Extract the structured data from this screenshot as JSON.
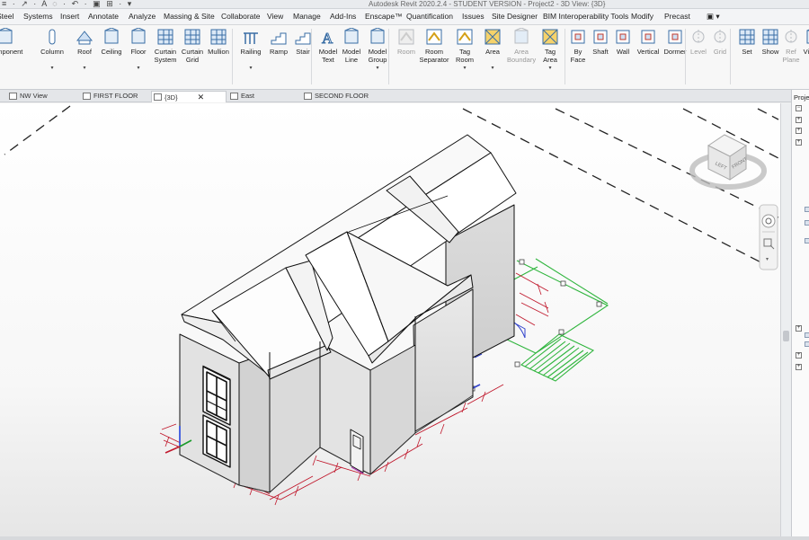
{
  "titlebar": {
    "quick_access": "≡ · ↗ · A  ◌ · ↶ · ▣  ⊞ · ▾",
    "title": "Autodesk Revit 2020.2.4 - STUDENT VERSION - Project2 - 3D View: {3D}"
  },
  "menu": {
    "tabs": [
      "Steel",
      "Systems",
      "Insert",
      "Annotate",
      "Analyze",
      "Massing & Site",
      "Collaborate",
      "View",
      "Manage",
      "Add-Ins",
      "Enscape™",
      "Quantification",
      "Issues",
      "Site Designer",
      "BIM Interoperability Tools",
      "Modify",
      "Precast",
      "▣ ▾"
    ]
  },
  "ribbon": {
    "buttons": [
      {
        "id": "component",
        "label": "Component",
        "icon": "component-icon",
        "disabled": false
      },
      {
        "id": "column",
        "label": "Column",
        "icon": "column-icon",
        "disabled": false,
        "dropdown": true
      },
      {
        "id": "roof",
        "label": "Roof",
        "icon": "roof-icon",
        "disabled": false,
        "dropdown": true
      },
      {
        "id": "ceiling",
        "label": "Ceiling",
        "icon": "ceiling-icon",
        "disabled": false
      },
      {
        "id": "floor",
        "label": "Floor",
        "icon": "floor-icon",
        "disabled": false,
        "dropdown": true
      },
      {
        "id": "curtain-system",
        "label": "Curtain\nSystem",
        "icon": "curtain-system-icon",
        "disabled": false
      },
      {
        "id": "curtain-grid",
        "label": "Curtain\nGrid",
        "icon": "curtain-grid-icon",
        "disabled": false
      },
      {
        "id": "mullion",
        "label": "Mullion",
        "icon": "mullion-icon",
        "disabled": false
      },
      {
        "id": "railing",
        "label": "Railing",
        "icon": "railing-icon",
        "disabled": false,
        "dropdown": true
      },
      {
        "id": "ramp",
        "label": "Ramp",
        "icon": "ramp-icon",
        "disabled": false
      },
      {
        "id": "stair",
        "label": "Stair",
        "icon": "stair-icon",
        "disabled": false
      },
      {
        "id": "model-text",
        "label": "Model\nText",
        "icon": "model-text-icon",
        "disabled": false
      },
      {
        "id": "model-line",
        "label": "Model\nLine",
        "icon": "model-line-icon",
        "disabled": false
      },
      {
        "id": "model-group",
        "label": "Model\nGroup",
        "icon": "model-group-icon",
        "disabled": false,
        "dropdown": true
      },
      {
        "id": "room",
        "label": "Room",
        "icon": "room-icon",
        "disabled": true
      },
      {
        "id": "room-separator",
        "label": "Room\nSeparator",
        "icon": "room-separator-icon",
        "disabled": false
      },
      {
        "id": "tag-room",
        "label": "Tag\nRoom",
        "icon": "tag-room-icon",
        "disabled": false,
        "dropdown": true
      },
      {
        "id": "area",
        "label": "Area",
        "icon": "area-icon",
        "disabled": false,
        "dropdown": true
      },
      {
        "id": "area-boundary",
        "label": "Area\nBoundary",
        "icon": "area-boundary-icon",
        "disabled": true
      },
      {
        "id": "tag-area",
        "label": "Tag\nArea",
        "icon": "tag-area-icon",
        "disabled": false,
        "dropdown": true
      },
      {
        "id": "by-face",
        "label": "By\nFace",
        "icon": "by-face-icon",
        "disabled": false
      },
      {
        "id": "shaft",
        "label": "Shaft",
        "icon": "shaft-icon",
        "disabled": false
      },
      {
        "id": "wall",
        "label": "Wall",
        "icon": "wall-opening-icon",
        "disabled": false
      },
      {
        "id": "vertical",
        "label": "Vertical",
        "icon": "vertical-opening-icon",
        "disabled": false
      },
      {
        "id": "dormer",
        "label": "Dormer",
        "icon": "dormer-icon",
        "disabled": false
      },
      {
        "id": "level",
        "label": "Level",
        "icon": "level-icon",
        "disabled": true
      },
      {
        "id": "grid",
        "label": "Grid",
        "icon": "grid-icon",
        "disabled": true
      },
      {
        "id": "set",
        "label": "Set",
        "icon": "set-workplane-icon",
        "disabled": false
      },
      {
        "id": "show",
        "label": "Show",
        "icon": "show-workplane-icon",
        "disabled": false
      },
      {
        "id": "ref-plane",
        "label": "Ref\nPlane",
        "icon": "ref-plane-icon",
        "disabled": true
      },
      {
        "id": "viewer",
        "label": "Viewer",
        "icon": "viewer-icon",
        "disabled": false
      }
    ]
  },
  "view_tabs": [
    {
      "label": "NW View",
      "icon": "section-view-icon",
      "active": false
    },
    {
      "label": "FIRST FLOOR",
      "icon": "floor-plan-icon",
      "active": false
    },
    {
      "label": "{3D}",
      "icon": "3d-view-icon",
      "active": true,
      "close": "✕"
    },
    {
      "label": "East",
      "icon": "elevation-view-icon",
      "active": false
    },
    {
      "label": "SECOND FLOOR",
      "icon": "floor-plan-icon",
      "active": false
    }
  ],
  "viewcube": {
    "faces": [
      "LEFT",
      "FRONT"
    ]
  },
  "project_browser": {
    "header": "Project Browser"
  },
  "colors": {
    "dimension_red": "#c0182c",
    "plan_green": "#2fb53d",
    "door_blue": "#3344cc",
    "door_magenta": "#b03ab8",
    "axis_green": "#1a9a2a",
    "axis_blue": "#2244dd"
  }
}
